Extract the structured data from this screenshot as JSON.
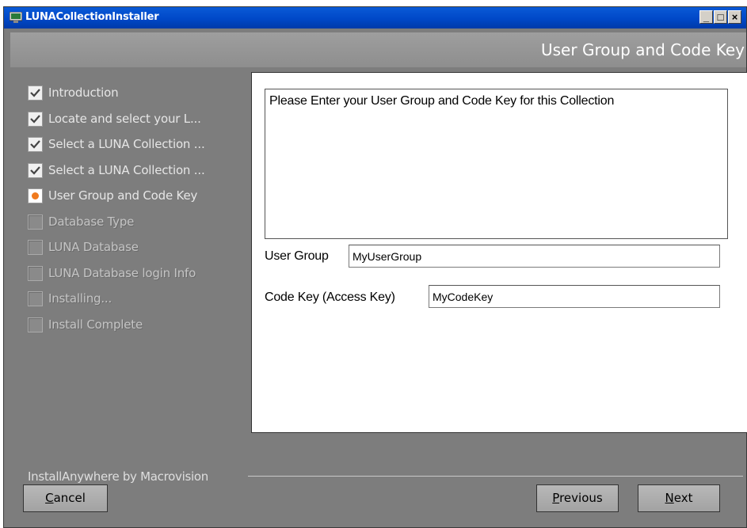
{
  "window": {
    "title": "LUNACollectionInstaller",
    "minimize_glyph": "_",
    "maximize_glyph": "□",
    "close_glyph": "×",
    "titlebar_color": "#0048c8"
  },
  "header": {
    "title": "User Group and Code Key"
  },
  "steps": [
    {
      "label": "Introduction",
      "state": "done"
    },
    {
      "label": "Locate and select your L...",
      "state": "done"
    },
    {
      "label": "Select a LUNA Collection ...",
      "state": "done"
    },
    {
      "label": "Select a LUNA Collection ...",
      "state": "done"
    },
    {
      "label": "User Group and Code Key",
      "state": "current"
    },
    {
      "label": "Database Type",
      "state": "pending"
    },
    {
      "label": "LUNA Database",
      "state": "pending"
    },
    {
      "label": "LUNA Database login Info",
      "state": "pending"
    },
    {
      "label": "Installing...",
      "state": "pending"
    },
    {
      "label": "Install Complete",
      "state": "pending"
    }
  ],
  "content": {
    "message": "Please Enter your User Group and Code Key for this Collection",
    "user_group_label": "User Group",
    "user_group_value": "MyUserGroup",
    "code_key_label": "Code Key (Access Key)",
    "code_key_value": "MyCodeKey"
  },
  "footer": {
    "brand": "InstallAnywhere by Macrovision",
    "cancel_label": "Cancel",
    "previous_label": "Previous",
    "next_label": "Next"
  },
  "colors": {
    "current_step_marker": "#f07a1e",
    "panel_background": "#7d7d7d"
  }
}
